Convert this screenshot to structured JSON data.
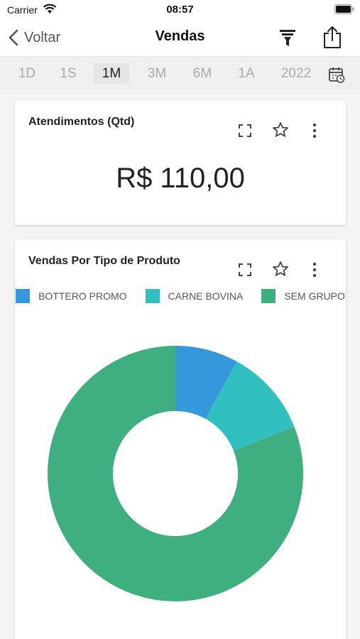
{
  "status_bar": {
    "carrier": "Carrier",
    "time": "08:57"
  },
  "nav": {
    "back_label": "Voltar",
    "title": "Vendas"
  },
  "periods": {
    "tabs": [
      {
        "label": "1D"
      },
      {
        "label": "1S"
      },
      {
        "label": "1M",
        "active": true
      },
      {
        "label": "3M"
      },
      {
        "label": "6M"
      },
      {
        "label": "1A"
      },
      {
        "label": "2022"
      }
    ]
  },
  "card_count": {
    "title": "Atendimentos (Qtd)",
    "value": "R$ 110,00"
  },
  "card_chart": {
    "title": "Vendas Por Tipo de Produto",
    "legend": [
      {
        "label": "BOTTERO PROMO",
        "color": "#3498db"
      },
      {
        "label": "CARNE BOVINA",
        "color": "#31bfbf"
      },
      {
        "label": "SEM GRUPO",
        "color": "#3fae80"
      }
    ]
  },
  "chart_data": {
    "type": "pie",
    "categories": [
      "BOTTERO PROMO",
      "CARNE BOVINA",
      "SEM GRUPO"
    ],
    "values": [
      8,
      11,
      81
    ],
    "colors": [
      "#3498db",
      "#31bfbf",
      "#3fae80"
    ],
    "title": "Vendas Por Tipo de Produto",
    "legend_position": "top",
    "donut": true
  }
}
